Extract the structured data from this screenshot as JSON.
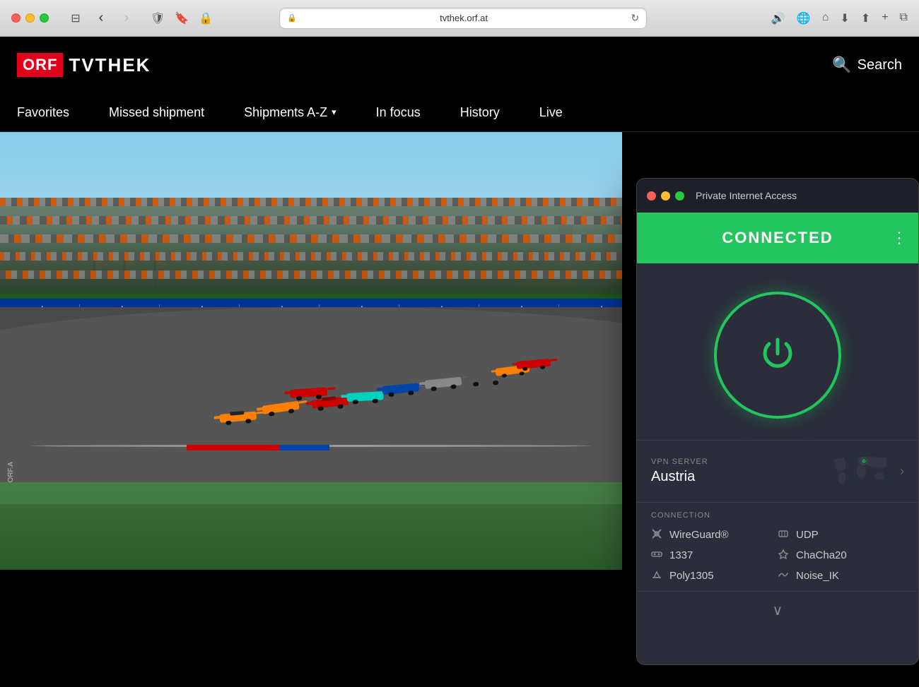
{
  "titlebar": {
    "url": "tvthek.orf.at",
    "lock_icon": "🔒",
    "back_icon": "‹",
    "forward_icon": "›",
    "reload_icon": "↻",
    "home_icon": "⌂",
    "download_icon": "⬇",
    "share_icon": "⬆",
    "add_tab_icon": "+",
    "tabs_icon": "⧉"
  },
  "orf": {
    "logo_box": "ORF",
    "logo_text": "TVTHEK",
    "search_label": "Search",
    "nav": {
      "favorites": "Favorites",
      "missed_shipment": "Missed shipment",
      "shipments_az": "Shipments A-Z",
      "in_focus": "In focus",
      "history": "History",
      "live": "Live"
    },
    "watermark": "ORF.A",
    "sponsor_items": [
      "crypto.com",
      "crypto.com",
      "crypto.com",
      "crypto.com",
      "crypto.com",
      "crypto.com",
      "crypto.com",
      "crypto.com"
    ]
  },
  "pia": {
    "title": "Private Internet Access",
    "status": "CONNECTED",
    "menu_dots": "⋮",
    "vpn_server_label": "VPN SERVER",
    "vpn_server_value": "Austria",
    "connection_label": "CONNECTION",
    "connection_items": [
      {
        "icon": "🔧",
        "text": "WireGuard®"
      },
      {
        "icon": "📡",
        "text": "UDP"
      },
      {
        "icon": "🔢",
        "text": "1337"
      },
      {
        "icon": "🔒",
        "text": "ChaCha20"
      },
      {
        "icon": "🔑",
        "text": "Poly1305"
      },
      {
        "icon": "〰",
        "text": "Noise_IK"
      }
    ]
  }
}
